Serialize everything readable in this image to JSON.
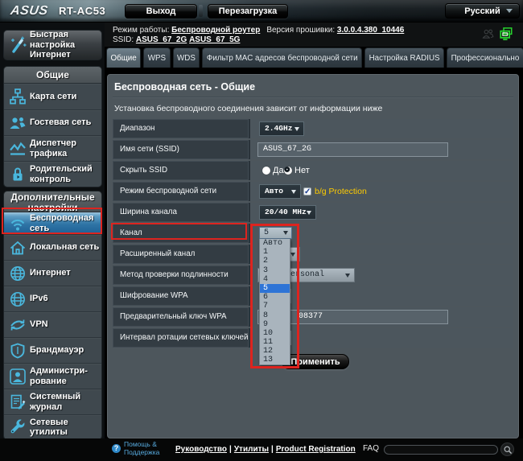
{
  "topbar": {
    "brand": "ASUS",
    "model": "RT-AC53",
    "logout_label": "Выход",
    "reboot_label": "Перезагрузка",
    "language": "Русский"
  },
  "infobar": {
    "mode_label": "Режим работы:",
    "mode_value": "Беспроводной роутер",
    "firmware_label": "Версия прошивки:",
    "firmware_value": "3.0.0.4.380_10446",
    "ssid_label": "SSID:",
    "ssid_2g": "ASUS_67_2G",
    "ssid_5g": "ASUS_67_5G",
    "icons": [
      "clients-icon",
      "network-status-icon"
    ]
  },
  "tabs": [
    {
      "label": "Общие",
      "active": true
    },
    {
      "label": "WPS",
      "active": false
    },
    {
      "label": "WDS",
      "active": false
    },
    {
      "label": "Фильтр MAC адресов беспроводной сети",
      "active": false
    },
    {
      "label": "Настройка RADIUS",
      "active": false
    },
    {
      "label": "Профессионально",
      "active": false
    }
  ],
  "sidebar": {
    "quick": {
      "label": "Быстрая\nнастройка\nИнтернет",
      "icon": "magic-wand-icon"
    },
    "sections": [
      {
        "title": "Общие",
        "items": [
          {
            "label": "Карта сети",
            "icon": "network-map-icon"
          },
          {
            "label": "Гостевая сеть",
            "icon": "guest-network-icon"
          },
          {
            "label": "Диспетчер\nтрафика",
            "icon": "traffic-manager-icon"
          },
          {
            "label": "Родительский\nконтроль",
            "icon": "parental-control-icon"
          }
        ]
      },
      {
        "title": "Дополнительные\nнастройки",
        "items": [
          {
            "label": "Беспроводная\nсеть",
            "icon": "wireless-icon",
            "selected": true
          },
          {
            "label": "Локальная сеть",
            "icon": "lan-icon"
          },
          {
            "label": "Интернет",
            "icon": "wan-icon"
          },
          {
            "label": "IPv6",
            "icon": "ipv6-icon"
          },
          {
            "label": "VPN",
            "icon": "vpn-icon"
          },
          {
            "label": "Брандмауэр",
            "icon": "firewall-icon"
          },
          {
            "label": "Администри-\nрование",
            "icon": "administration-icon"
          },
          {
            "label": "Системный\nжурнал",
            "icon": "system-log-icon"
          },
          {
            "label": "Сетевые\nутилиты",
            "icon": "network-tools-icon"
          }
        ]
      }
    ]
  },
  "page": {
    "title": "Беспроводная сеть - Общие",
    "description": "Установка беспроводного соединения зависит от информации ниже"
  },
  "form": {
    "rows": [
      {
        "label": "Диапазон",
        "type": "select",
        "value": "2.4GHz"
      },
      {
        "label": "Имя сети (SSID)",
        "type": "text",
        "value": "ASUS_67_2G"
      },
      {
        "label": "Скрыть SSID",
        "type": "radio",
        "options": [
          "Да",
          "Нет"
        ],
        "selected": "Нет"
      },
      {
        "label": "Режим беспроводной сети",
        "type": "select",
        "value": "Авто",
        "checkbox_label": "b/g Protection",
        "checkbox_checked": true
      },
      {
        "label": "Ширина канала",
        "type": "select",
        "value": "20/40 MHz"
      },
      {
        "label": "Канал",
        "type": "select",
        "value": "5",
        "open": true
      },
      {
        "label": "Расширенный канал",
        "type": "select",
        "value": ""
      },
      {
        "label": "Метод проверки подлинности",
        "type": "select",
        "value": "WPA2-Personal"
      },
      {
        "label": "Шифрование WPA",
        "type": "select",
        "value": ""
      },
      {
        "label": "Предварительный ключ WPA",
        "type": "text",
        "value": "08377"
      },
      {
        "label": "Интервал ротации сетевых ключей",
        "type": "text",
        "value": ""
      }
    ],
    "apply_label": "Применить"
  },
  "channel_dropdown": {
    "options": [
      "Авто",
      "1",
      "2",
      "3",
      "4",
      "5",
      "6",
      "7",
      "8",
      "9",
      "10",
      "11",
      "12",
      "13"
    ],
    "selected": "5",
    "selected_index": 5
  },
  "annotations": {
    "color": "#dd241f",
    "boxes": [
      "sidebar-wireless-item",
      "channel-label",
      "channel-dropdown"
    ]
  },
  "footer": {
    "help_label": "Помощь &\nПоддержка",
    "links": [
      "Руководство",
      "Утилиты",
      "Product Registration"
    ],
    "separator": "|",
    "faq_label": "FAQ",
    "faq_value": ""
  },
  "colors": {
    "annotation_red": "#dd241f",
    "accent_cyan": "#4ab7dd",
    "selection_blue": "#2e74d6",
    "status_green": "#27d12e",
    "warning_orange": "#ffcc00"
  }
}
